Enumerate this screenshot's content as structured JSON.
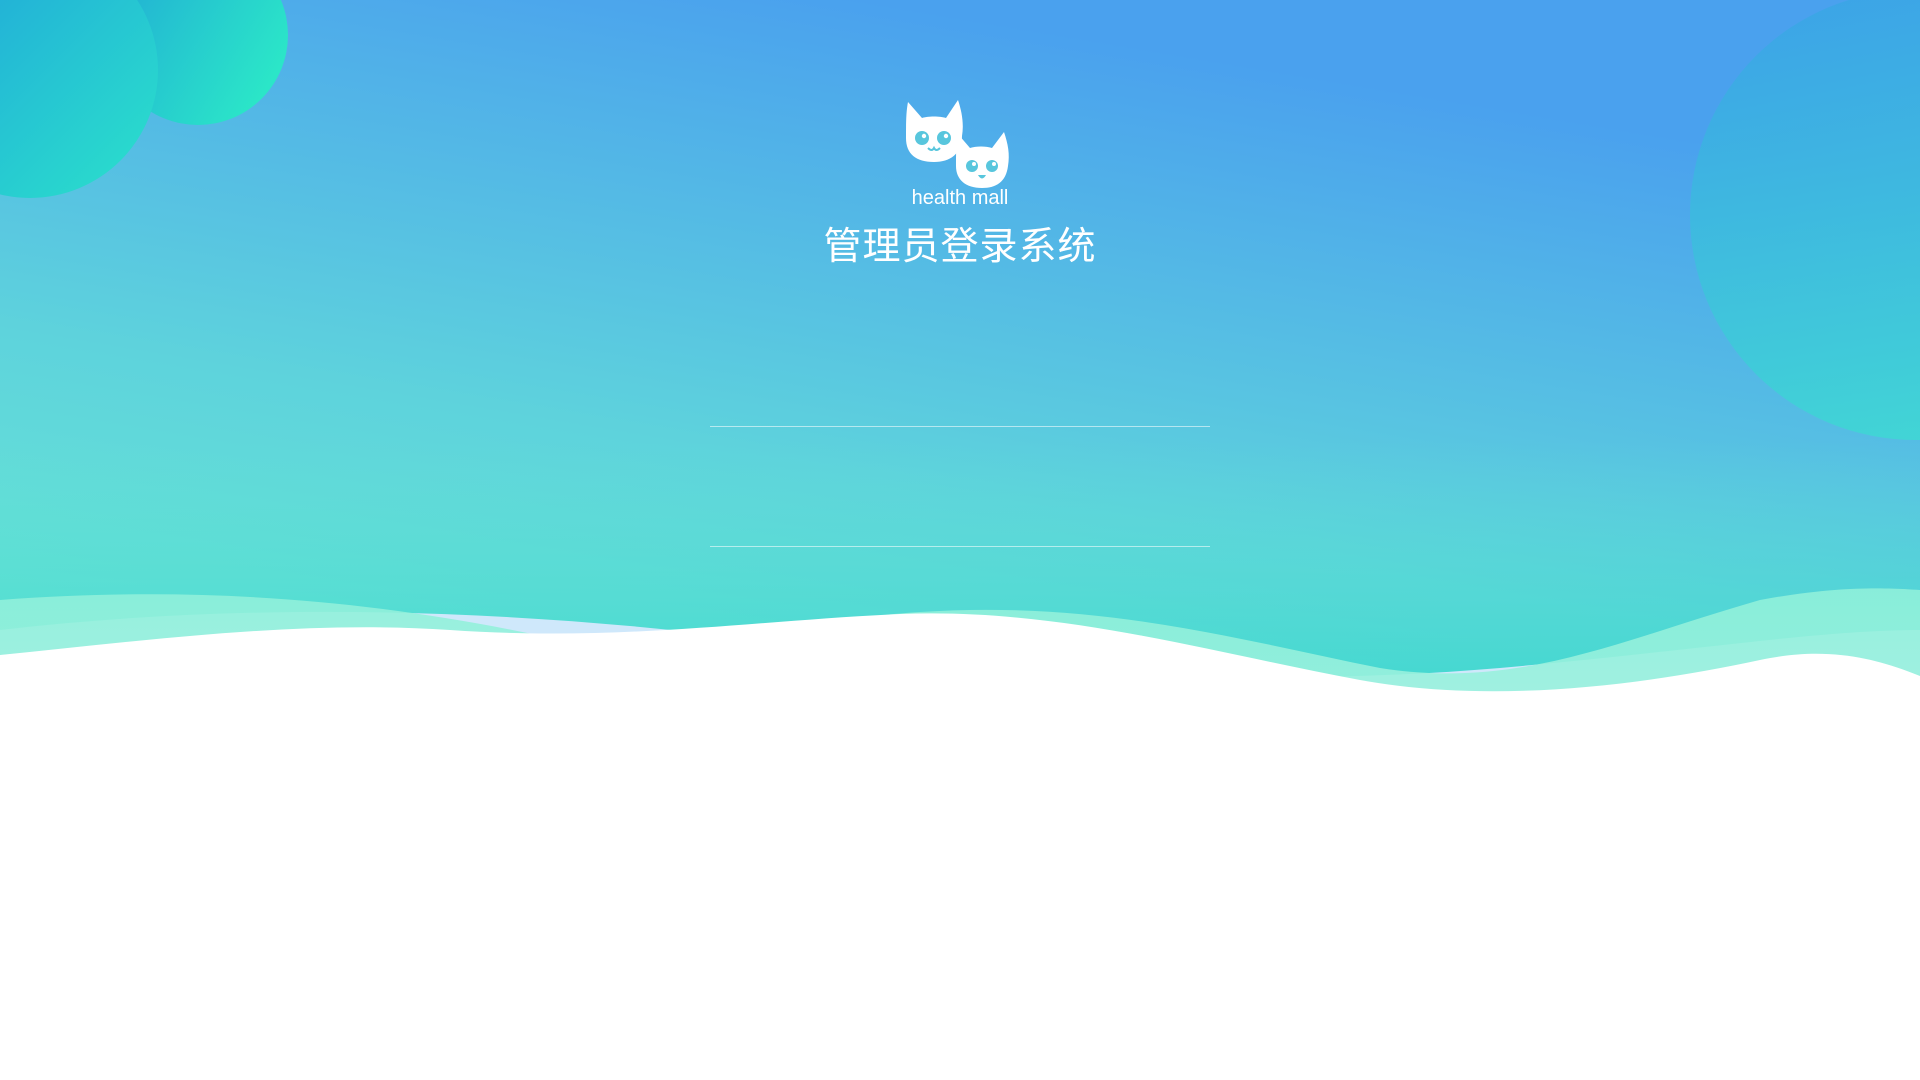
{
  "brand": {
    "logo_text": "health mall",
    "system_title": "管理员登录系统"
  },
  "login_form": {
    "username": {
      "value": "",
      "placeholder": ""
    },
    "password": {
      "value": "",
      "placeholder": ""
    }
  },
  "colors": {
    "gradient_top_right": "#4aa1ee",
    "gradient_mid": "#62dfd2",
    "gradient_bottom": "#3bd6cc",
    "wave_light_blue": "#cfe8fb",
    "wave_mint": "#b6f3e6",
    "bubble_teal": "#29e3c5",
    "bubble_blue": "#27a6d8"
  },
  "icons": {
    "logo": "two-cats-logo-icon"
  }
}
